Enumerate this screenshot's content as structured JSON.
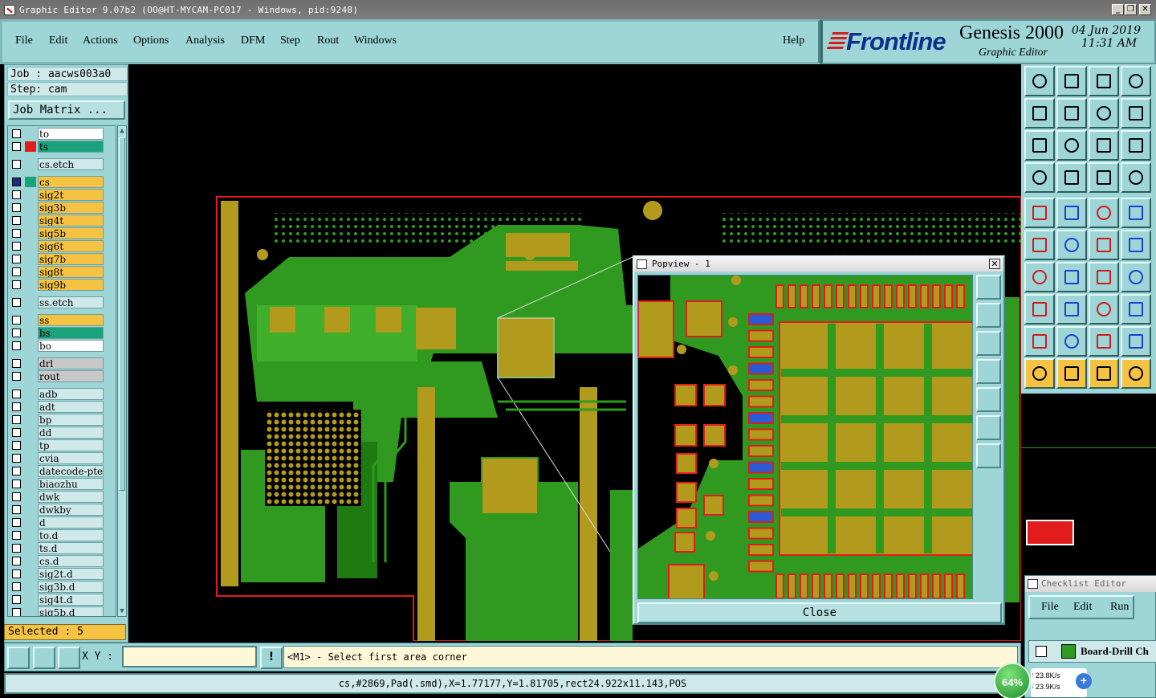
{
  "window": {
    "title": "Graphic Editor 9.07b2 (OO@HT-MYCAM-PC017 - Windows, pid:9248)",
    "controls": [
      "_",
      "❐",
      "✕"
    ]
  },
  "menu": {
    "items": [
      {
        "label": "File"
      },
      {
        "label": "Edit"
      },
      {
        "label": "Actions"
      },
      {
        "label": "Options"
      },
      {
        "label": "Analysis"
      },
      {
        "label": "DFM"
      },
      {
        "label": "Step"
      },
      {
        "label": "Rout"
      },
      {
        "label": "Windows"
      }
    ],
    "help": "Help"
  },
  "brand": {
    "logo": "Frontline",
    "product": "Genesis 2000",
    "subtitle": "Graphic Editor",
    "date": "04 Jun 2019",
    "time": "11:31 AM"
  },
  "left": {
    "job": "Job : aacws003a0",
    "step": "Step: cam",
    "job_matrix": "Job Matrix ...",
    "selected": "Selected : 5",
    "layers": [
      {
        "name": "to",
        "color": "#ffffff",
        "mark": "",
        "gap": 0
      },
      {
        "name": "ts",
        "color": "#1aa37a",
        "mark": "#e21c1c",
        "gap": 0
      },
      {
        "name": "cs.etch",
        "color": "#cfe9ea",
        "mark": "",
        "gap": 6
      },
      {
        "name": "cs",
        "color": "#f5c242",
        "mark": "#1aa37a",
        "gap": 6,
        "active": true
      },
      {
        "name": "sig2t",
        "color": "#f5c242",
        "mark": "",
        "gap": 0
      },
      {
        "name": "sig3b",
        "color": "#f5c242",
        "mark": "",
        "gap": 0
      },
      {
        "name": "sig4t",
        "color": "#f5c242",
        "mark": "",
        "gap": 0
      },
      {
        "name": "sig5b",
        "color": "#f5c242",
        "mark": "",
        "gap": 0
      },
      {
        "name": "sig6t",
        "color": "#f5c242",
        "mark": "",
        "gap": 0
      },
      {
        "name": "sig7b",
        "color": "#f5c242",
        "mark": "",
        "gap": 0
      },
      {
        "name": "sig8t",
        "color": "#f5c242",
        "mark": "",
        "gap": 0
      },
      {
        "name": "sig9b",
        "color": "#f5c242",
        "mark": "",
        "gap": 0
      },
      {
        "name": "ss.etch",
        "color": "#cfe9ea",
        "mark": "",
        "gap": 6
      },
      {
        "name": "ss",
        "color": "#f5c242",
        "mark": "",
        "gap": 6
      },
      {
        "name": "bs",
        "color": "#1aa37a",
        "mark": "",
        "gap": 0
      },
      {
        "name": "bo",
        "color": "#ffffff",
        "mark": "",
        "gap": 0
      },
      {
        "name": "drl",
        "color": "#c8c8c8",
        "mark": "",
        "gap": 6
      },
      {
        "name": "rout",
        "color": "#c8c8c8",
        "mark": "",
        "gap": 0
      },
      {
        "name": "adb",
        "color": "#cfe9ea",
        "mark": "",
        "gap": 6
      },
      {
        "name": "adt",
        "color": "#cfe9ea",
        "mark": "",
        "gap": 0
      },
      {
        "name": "bp",
        "color": "#cfe9ea",
        "mark": "",
        "gap": 0
      },
      {
        "name": "dd",
        "color": "#cfe9ea",
        "mark": "",
        "gap": 0
      },
      {
        "name": "tp",
        "color": "#cfe9ea",
        "mark": "",
        "gap": 0
      },
      {
        "name": "cvia",
        "color": "#cfe9ea",
        "mark": "",
        "gap": 0
      },
      {
        "name": "datecode-pte",
        "color": "#cfe9ea",
        "mark": "",
        "gap": 0
      },
      {
        "name": "biaozhu",
        "color": "#cfe9ea",
        "mark": "",
        "gap": 0
      },
      {
        "name": "dwk",
        "color": "#cfe9ea",
        "mark": "",
        "gap": 0
      },
      {
        "name": "dwkby",
        "color": "#cfe9ea",
        "mark": "",
        "gap": 0
      },
      {
        "name": "d",
        "color": "#cfe9ea",
        "mark": "",
        "gap": 0
      },
      {
        "name": "to.d",
        "color": "#cfe9ea",
        "mark": "",
        "gap": 0
      },
      {
        "name": "ts.d",
        "color": "#cfe9ea",
        "mark": "",
        "gap": 0
      },
      {
        "name": "cs.d",
        "color": "#cfe9ea",
        "mark": "",
        "gap": 0
      },
      {
        "name": "sig2t.d",
        "color": "#cfe9ea",
        "mark": "",
        "gap": 0
      },
      {
        "name": "sig3b.d",
        "color": "#cfe9ea",
        "mark": "",
        "gap": 0
      },
      {
        "name": "sig4t.d",
        "color": "#cfe9ea",
        "mark": "",
        "gap": 0
      },
      {
        "name": "sig5b.d",
        "color": "#cfe9ea",
        "mark": "",
        "gap": 0
      }
    ]
  },
  "popview": {
    "title": "Popview - 1",
    "close_label": "Close"
  },
  "checklist": {
    "title": "Checklist Editor",
    "menu": [
      "File",
      "Edit",
      "Run"
    ],
    "row": "Board-Drill Ch"
  },
  "command": {
    "xy_label": "X Y :",
    "xy_value": "",
    "prompt": "<M1> - Select first area corner",
    "status": "cs,#2869,Pad(.smd),X=1.77177,Y=1.81705,rect24.922x11.143,POS"
  },
  "network": {
    "percent": "64%",
    "up": "23.8K/s",
    "down": "23.9K/s"
  },
  "colors": {
    "panel": "#9ed6d8",
    "copper": "#b29a1c",
    "plane": "#2f9a1f",
    "outline": "#e21c1c",
    "pad_blue": "#2a5bd6"
  }
}
